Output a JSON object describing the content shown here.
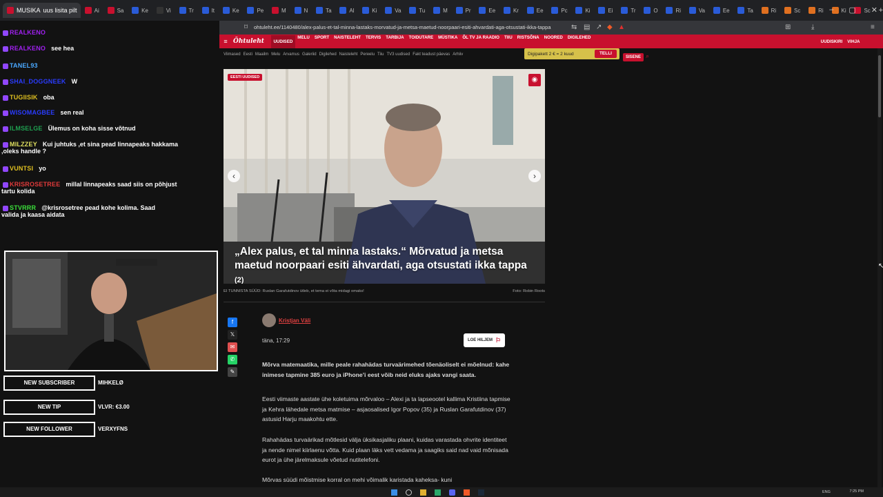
{
  "tabs": [
    {
      "label": "MUSIKA",
      "color": "#c8102e"
    },
    {
      "label": "Ai",
      "color": "#c8102e"
    },
    {
      "label": "Sa",
      "color": "#c8102e"
    },
    {
      "label": "Ke",
      "color": "#2a5bd7"
    },
    {
      "label": "Vi",
      "color": "#333333"
    },
    {
      "label": "Tr",
      "color": "#2a5bd7"
    },
    {
      "label": "It",
      "color": "#2a5bd7"
    },
    {
      "label": "Ke",
      "color": "#2a5bd7"
    },
    {
      "label": "Pe",
      "color": "#2a5bd7"
    },
    {
      "label": "M",
      "color": "#c8102e"
    },
    {
      "label": "N",
      "color": "#2a5bd7"
    },
    {
      "label": "Ta",
      "color": "#2a5bd7"
    },
    {
      "label": "Al",
      "color": "#2a5bd7"
    },
    {
      "label": "Ki",
      "color": "#2a5bd7"
    },
    {
      "label": "Va",
      "color": "#2a5bd7"
    },
    {
      "label": "Tu",
      "color": "#2a5bd7"
    },
    {
      "label": "M",
      "color": "#2a5bd7"
    },
    {
      "label": "Pr",
      "color": "#2a5bd7"
    },
    {
      "label": "Ee",
      "color": "#2a5bd7"
    },
    {
      "label": "Kr",
      "color": "#2a5bd7"
    },
    {
      "label": "Ee",
      "color": "#2a5bd7"
    },
    {
      "label": "Pc",
      "color": "#2a5bd7"
    },
    {
      "label": "Ki",
      "color": "#2a5bd7"
    },
    {
      "label": "Ei",
      "color": "#2a5bd7"
    },
    {
      "label": "Tr",
      "color": "#2a5bd7"
    },
    {
      "label": "O",
      "color": "#2a5bd7"
    },
    {
      "label": "Ri",
      "color": "#2a5bd7"
    },
    {
      "label": "Va",
      "color": "#2a5bd7"
    },
    {
      "label": "Ee",
      "color": "#2a5bd7"
    },
    {
      "label": "Ta",
      "color": "#2a5bd7"
    },
    {
      "label": "Ri",
      "color": "#e07020"
    },
    {
      "label": "Sc",
      "color": "#e07020"
    },
    {
      "label": "Ri",
      "color": "#e07020"
    },
    {
      "label": "Ki",
      "color": "#e07020"
    },
    {
      "label": "Sc",
      "color": "#c8102e"
    }
  ],
  "active_tab_label": "uus lisita pilt",
  "address": {
    "url": "ohtuleht.ee/1140480/alex-palus-et-tal-minna-lastaks-morvatud-ja-metsa-maetud-noorpaari-esiti-ahvardati-aga-otsustati-ikka-tappa"
  },
  "site": {
    "logo": "Õhtuleht",
    "nav": [
      "UUDISED",
      "MELU",
      "SPORT",
      "NAISTELEHT",
      "TERVIS",
      "TARBIJA",
      "TOIDUTARE",
      "MÜSTIKA",
      "ÕL TV JA RAADIO",
      "TIIU",
      "RISTSÕNA",
      "NOORED",
      "DIGILEHED"
    ],
    "nav_right": [
      "UUDISKIRI",
      "VIHJA"
    ],
    "subnav": [
      "Viimased",
      "Eesti",
      "Maailm",
      "Melu",
      "Arvamus",
      "Galeriid",
      "Digilehed",
      "Naisteleht",
      "Pereelu",
      "Tiiu",
      "TV3 uudised",
      "Fakt teadust päevas",
      "Arhiiv"
    ],
    "promo": "Digipakett 2 € = 2 kuud",
    "promo_button": "TELLI",
    "login": "SISENE"
  },
  "hero": {
    "tag": "EESTI UUDISED",
    "title": "„Alex palus, et tal minna lastaks.“ Mõrvatud ja metsa maetud noorpaari esiti ähvardati, aga otsustati ikka tappa",
    "comment_count": "(2)",
    "caption": "EI TUNNISTA SÜÜD: Ruslan Garafutdinov ütleb, et tema ei võta midagi omaks!",
    "photo_credit": "Foto: Robin Roots"
  },
  "article": {
    "author": "Kristjan Väli",
    "time": "täna, 17:29",
    "read_later": "LOE HILJEM",
    "lead": "Mõrva matemaatika, mille peale rahahädas turvaärimehed tõenäoliselt ei mõelnud: kahe inimese tapmine 385 euro ja iPhone’i eest võib neid eluks ajaks vangi saata.",
    "p1": "Eesti viimaste aastate ühe koletuima mõrvaloo – Alexi ja ta lapseootel kallima Kristiina tapmise ja Kehra lähedale metsa matmise – asjaosalised Igor Popov (35) ja Ruslan Garafutdinov (37) astusid Harju maakohtu ette.",
    "p2": "Rahahädas turvaärikad mõtlesid välja üksikasjaliku plaani, kuidas varastada ohvrite identiteet ja nende nimel kiirlaenu võtta. Kuid plaan läks vett vedama ja saagiks said nad vaid mõnisada eurot ja ühe järelmaksule võetud nutitelefoni.",
    "p3": "Mõrvas süüdi mõistmise korral on mehi võimalik karistada kaheksa- kuni"
  },
  "chat": [
    {
      "user": "REALKENO",
      "text": "",
      "color": "#a020f0"
    },
    {
      "user": "REALKENO",
      "text": "see hea",
      "color": "#a020f0"
    },
    {
      "user": "TANEL93",
      "text": "",
      "color": "#4aa8ff"
    },
    {
      "user": "SHAI_DOGGNEEK",
      "text": "W",
      "color": "#2a3cff"
    },
    {
      "user": "TUGIISIK",
      "text": "oba",
      "color": "#e0c020"
    },
    {
      "user": "WISOMAGBEE",
      "text": "sen real",
      "color": "#2a3cff"
    },
    {
      "user": "ILMSELGE",
      "text": "Ülemus on koha sisse võtnud",
      "color": "#1fa050"
    },
    {
      "user": "MILZZEY",
      "text": "Kui juhtuks ,et sina pead linnapeaks hakkama",
      "text2": ",oleks handle ?",
      "color": "#e0e060"
    },
    {
      "user": "VUNTSI",
      "text": "yo",
      "color": "#e0c020"
    },
    {
      "user": "KRISROSETREE",
      "text": "millal linnapeaks saad siis on põhjust",
      "text2": "tartu kolida",
      "color": "#e03a3a"
    },
    {
      "user": "STVRRR",
      "text": "@krisrosetree pead kohe kolima. Saad",
      "text2": "valida ja kaasa aidata",
      "color": "#3be03b"
    }
  ],
  "alerts": [
    {
      "label": "NEW SUBSCRIBER",
      "value": "MIHKELØ"
    },
    {
      "label": "NEW TIP",
      "value": "VLVR: €3.00"
    },
    {
      "label": "NEW FOLLOWER",
      "value": "VERXYFNS"
    }
  ],
  "taskbar": {
    "lang": "ENG",
    "time": "7:25 PM"
  }
}
